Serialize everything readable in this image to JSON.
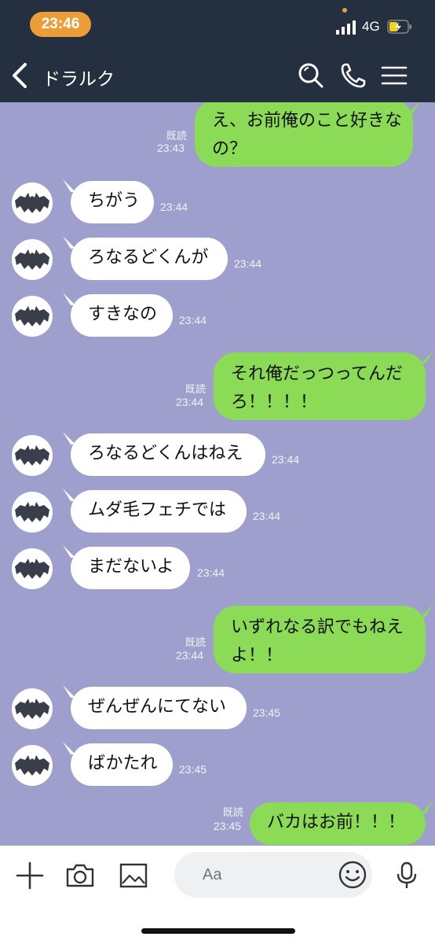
{
  "status": {
    "time": "23:46",
    "network": "4G"
  },
  "header": {
    "title": "ドラルク"
  },
  "messages": [
    {
      "dir": "out",
      "lines": [
        "え、お前俺のこと好きな",
        "の？"
      ],
      "read": "既読",
      "time": "23:43"
    },
    {
      "dir": "in",
      "text": "ちがう",
      "time": "23:44"
    },
    {
      "dir": "in",
      "text": "ろなるどくんが",
      "time": "23:44"
    },
    {
      "dir": "in",
      "text": "すきなの",
      "time": "23:44"
    },
    {
      "dir": "out",
      "lines": [
        "それ俺だっつってんだ",
        "ろ！！！！"
      ],
      "read": "既読",
      "time": "23:44"
    },
    {
      "dir": "in",
      "text": "ろなるどくんはねえ",
      "time": "23:44"
    },
    {
      "dir": "in",
      "text": "ムダ毛フェチでは",
      "time": "23:44"
    },
    {
      "dir": "in",
      "text": "まだないよ",
      "time": "23:44"
    },
    {
      "dir": "out",
      "lines": [
        "いずれなる訳でもねえ",
        "よ！！"
      ],
      "read": "既読",
      "time": "23:44"
    },
    {
      "dir": "in",
      "text": "ぜんぜんにてない",
      "time": "23:45"
    },
    {
      "dir": "in",
      "text": "ばかたれ",
      "time": "23:45"
    },
    {
      "dir": "out",
      "lines": [
        "バカはお前！！！"
      ],
      "read": "既読",
      "time": "23:45"
    }
  ],
  "input": {
    "placeholder": "Aa"
  },
  "icons": {
    "back": "chevron-left-icon",
    "search": "search-icon",
    "call": "phone-icon",
    "menu": "menu-icon",
    "add": "plus-icon",
    "camera": "camera-icon",
    "image": "image-icon",
    "emoji": "emoji-icon",
    "mic": "microphone-icon",
    "avatar": "bat-icon"
  },
  "colors": {
    "chat_bg": "#9e9fcd",
    "header_bg": "#24303f",
    "outgoing": "#8cdb57",
    "incoming": "#ffffff",
    "time_pill": "#eb9d38"
  }
}
